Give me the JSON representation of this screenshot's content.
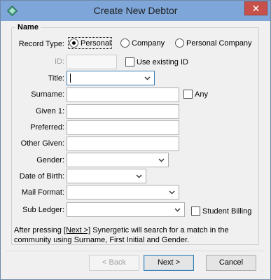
{
  "window": {
    "title": "Create New Debtor",
    "close_label": "✕"
  },
  "group": {
    "legend": "Name"
  },
  "record_type": {
    "label": "Record Type:",
    "options": [
      "Personal",
      "Company",
      "Personal Company"
    ],
    "selected": "Personal"
  },
  "id_field": {
    "label": "ID:",
    "value": "",
    "use_existing_label": "Use existing ID"
  },
  "title_field": {
    "label": "Title:",
    "value": ""
  },
  "surname": {
    "label": "Surname:",
    "value": "",
    "any_label": "Any"
  },
  "given1": {
    "label": "Given 1:",
    "value": ""
  },
  "preferred": {
    "label": "Preferred:",
    "value": ""
  },
  "other_given": {
    "label": "Other Given:",
    "value": ""
  },
  "gender": {
    "label": "Gender:",
    "value": ""
  },
  "dob": {
    "label": "Date of Birth:",
    "value": ""
  },
  "mail_format": {
    "label": "Mail Format:",
    "value": ""
  },
  "sub_ledger": {
    "label": "Sub Ledger:",
    "value": "",
    "student_billing_label": "Student Billing"
  },
  "info": {
    "before": "After pressing ",
    "underlined": "[Next >]",
    "after": " Synergetic will search for a match in the community using Surname, First Initial and Gender."
  },
  "buttons": {
    "back": "< Back",
    "next": "Next >",
    "cancel": "Cancel"
  },
  "colors": {
    "titlebar": "#7ea6d8",
    "close": "#c7504a",
    "default_button_border": "#3c7fb1"
  },
  "icons": {
    "app": "diamond-app-icon",
    "close": "close-icon",
    "dropdown": "chevron-down-icon"
  }
}
